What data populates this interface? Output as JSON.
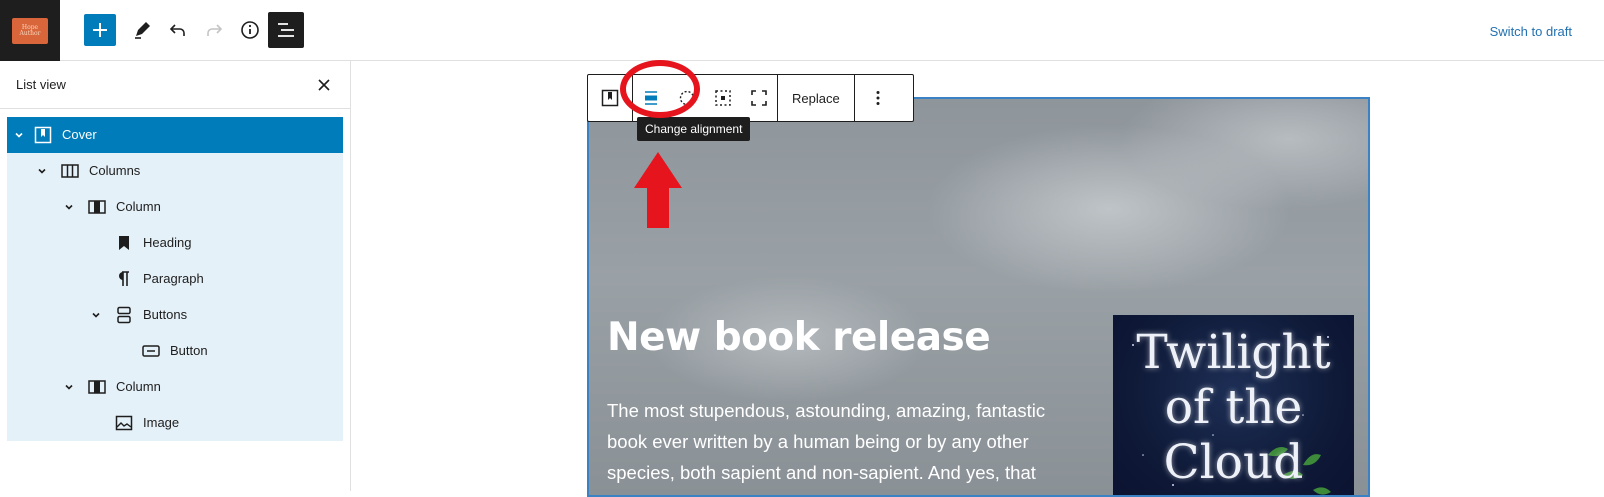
{
  "topbar": {
    "site_logo_text": "Hope Author",
    "switch_draft_label": "Switch to draft",
    "buttons": {
      "add": "add-block",
      "tools": "pencil-icon",
      "undo": "undo-icon",
      "redo": "redo-icon",
      "details": "info-icon",
      "list_view": "list-view-icon"
    }
  },
  "sidebar": {
    "title": "List view",
    "items": [
      {
        "label": "Cover",
        "icon": "cover-icon",
        "level": 0,
        "expanded": true,
        "selected": true
      },
      {
        "label": "Columns",
        "icon": "columns-icon",
        "level": 1,
        "expanded": true
      },
      {
        "label": "Column",
        "icon": "column-icon",
        "level": 2,
        "expanded": true
      },
      {
        "label": "Heading",
        "icon": "bookmark-icon",
        "level": 3
      },
      {
        "label": "Paragraph",
        "icon": "pilcrow-icon",
        "level": 3
      },
      {
        "label": "Buttons",
        "icon": "buttons-icon",
        "level": 3,
        "expanded": true
      },
      {
        "label": "Button",
        "icon": "button-icon",
        "level": 4
      },
      {
        "label": "Column",
        "icon": "column-icon",
        "level": 2,
        "expanded": true
      },
      {
        "label": "Image",
        "icon": "image-icon",
        "level": 3
      }
    ]
  },
  "block_toolbar": {
    "replace_label": "Replace",
    "tooltip": "Change alignment"
  },
  "cover": {
    "heading": "New book release",
    "paragraph": "The most stupendous, astounding, amazing, fantastic book ever written by a human being or by any other species, both sapient and non-sapient. And yes, that",
    "book_title": "Twilight of the Cloud"
  },
  "colors": {
    "accent": "#007cba",
    "annotation": "#e5141d",
    "selection": "#e5f1f8"
  }
}
